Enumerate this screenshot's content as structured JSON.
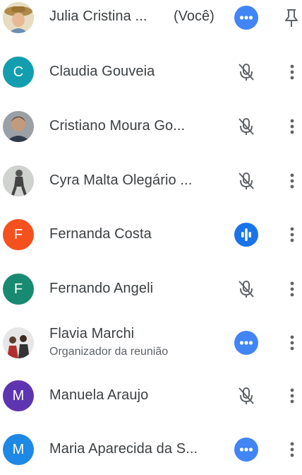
{
  "colors": {
    "blue_accent": "#4285f4",
    "teal": "#129eaf",
    "orange": "#f4511e",
    "green": "#188a71",
    "purple": "#5e35b1",
    "blue": "#1e88e5",
    "muted_icon": "#5f6368"
  },
  "participants": [
    {
      "name": "Julia Cristina ...",
      "suffix": "(Você)",
      "avatar": "photo",
      "status_icon": "more-horiz-icon",
      "action_icon": "pin-icon"
    },
    {
      "name": "Claudia Gouveia",
      "initial": "C",
      "avatar": "initial",
      "status_icon": "mic-off-icon",
      "action_icon": "more-vert-icon"
    },
    {
      "name": "Cristiano Moura Go...",
      "avatar": "photo",
      "status_icon": "mic-off-icon",
      "action_icon": "more-vert-icon"
    },
    {
      "name": "Cyra Malta Olegário ...",
      "avatar": "photo",
      "status_icon": "mic-off-icon",
      "action_icon": "more-vert-icon"
    },
    {
      "name": "Fernanda Costa",
      "initial": "F",
      "avatar": "initial",
      "status_icon": "audio-level-icon",
      "action_icon": "more-vert-icon"
    },
    {
      "name": "Fernando Angeli",
      "initial": "F",
      "avatar": "initial",
      "status_icon": "mic-off-icon",
      "action_icon": "more-vert-icon"
    },
    {
      "name": "Flavia Marchi",
      "subtitle": "Organizador da reunião",
      "avatar": "photo",
      "status_icon": "more-horiz-icon",
      "action_icon": "more-vert-icon"
    },
    {
      "name": "Manuela Araujo",
      "initial": "M",
      "avatar": "initial",
      "status_icon": "mic-off-icon",
      "action_icon": "more-vert-icon"
    },
    {
      "name": "Maria Aparecida da S...",
      "initial": "M",
      "avatar": "initial",
      "status_icon": "more-horiz-icon",
      "action_icon": "more-vert-icon"
    }
  ]
}
